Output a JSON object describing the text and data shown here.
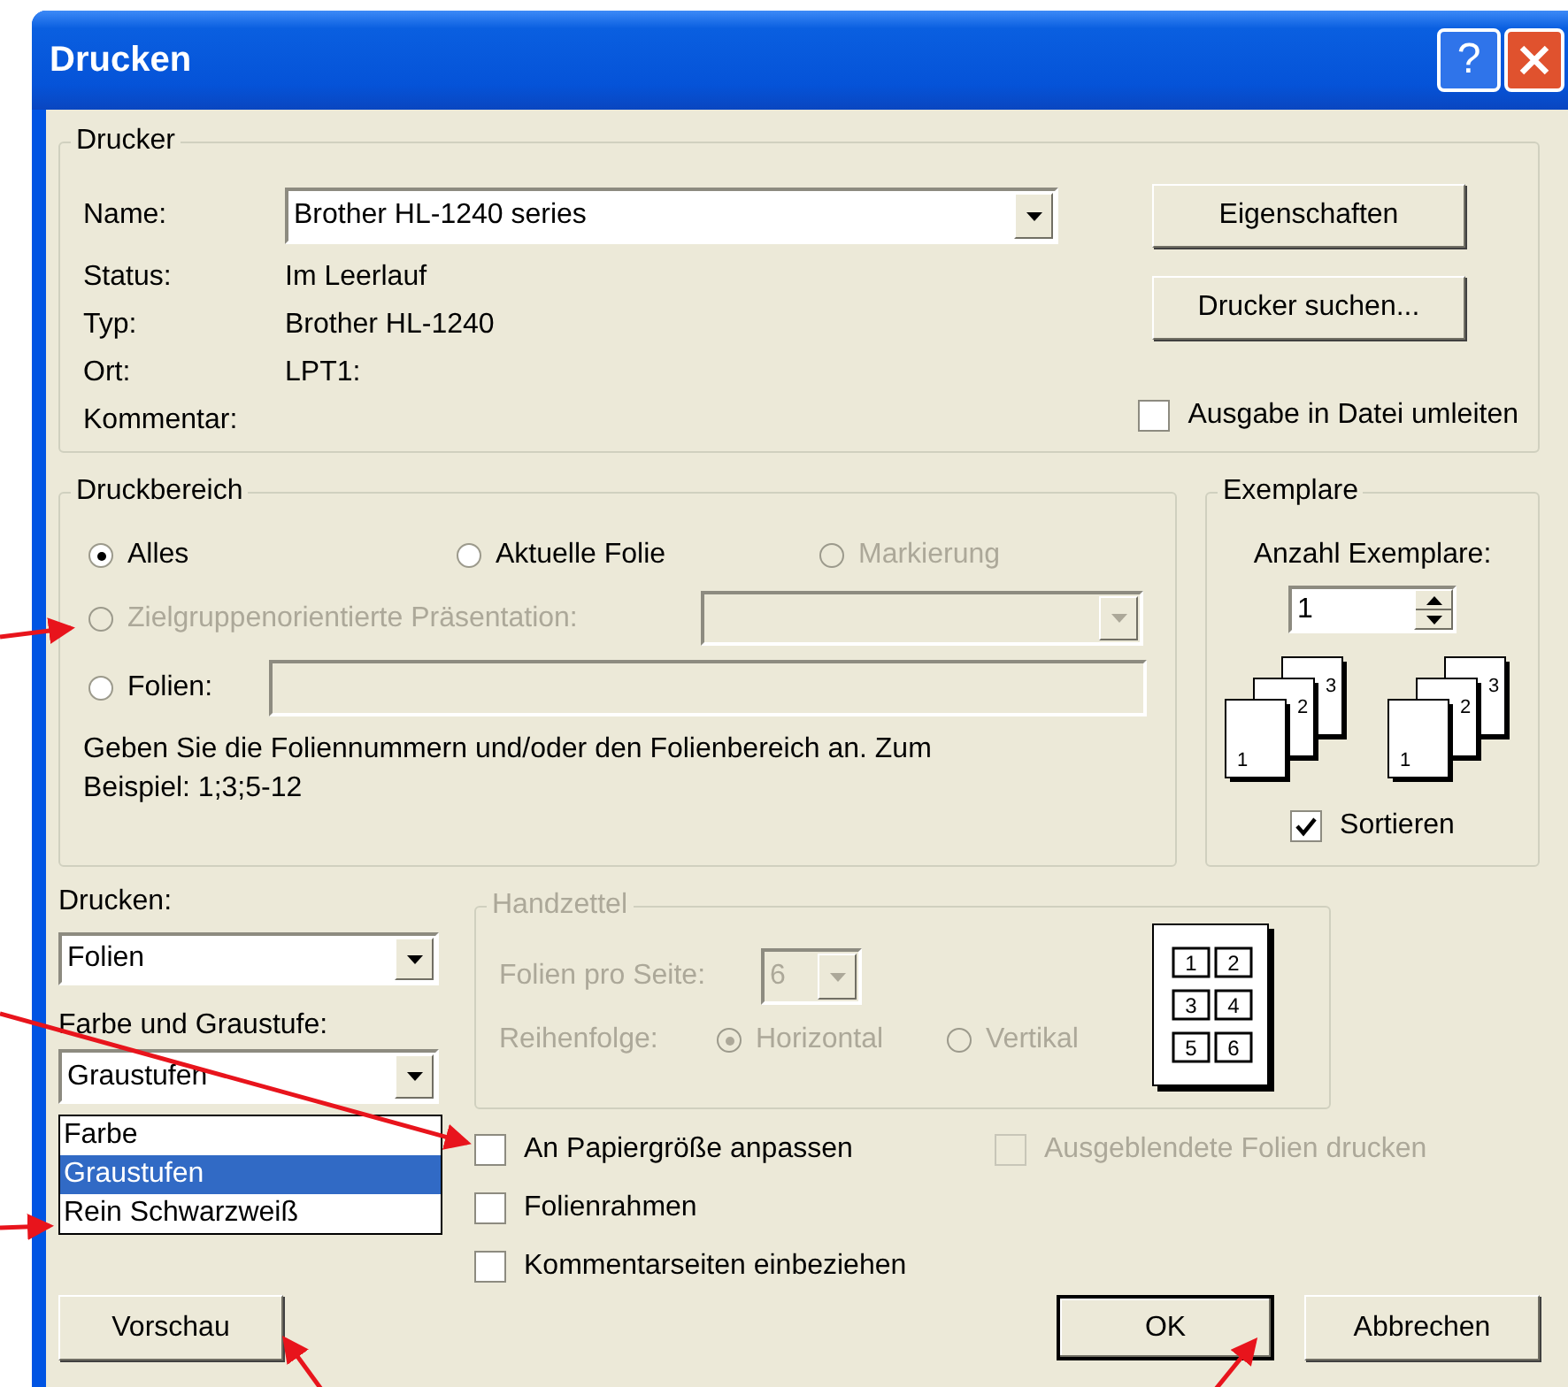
{
  "window": {
    "title": "Drucken",
    "help_button": "?"
  },
  "printer": {
    "legend": "Drucker",
    "name_label": "Name:",
    "name_value": "Brother HL-1240 series",
    "info": [
      {
        "label": "Status:",
        "value": "Im Leerlauf"
      },
      {
        "label": "Typ:",
        "value": "Brother HL-1240"
      },
      {
        "label": "Ort:",
        "value": "LPT1:"
      },
      {
        "label": "Kommentar:"
      }
    ],
    "buttons": [
      "Eigenschaften",
      "Drucker suchen..."
    ],
    "print_to_file": {
      "label": "Ausgabe in Datei umleiten",
      "checked": false
    }
  },
  "range": {
    "legend": "Druckbereich",
    "options": [
      {
        "label": "Alles",
        "selected": true,
        "disabled": false
      },
      {
        "label": "Aktuelle Folie",
        "selected": false,
        "disabled": false
      },
      {
        "label": "Markierung",
        "selected": false,
        "disabled": true
      },
      {
        "label": "Zielgruppenorientierte Präsentation:",
        "selected": false,
        "disabled": true
      },
      {
        "label": "Folien:",
        "selected": false,
        "disabled": false
      }
    ],
    "hint": "Geben Sie die Foliennummern und/oder den Folienbereich an. Zum Beispiel: 1;3;5-12"
  },
  "copies": {
    "legend": "Exemplare",
    "count_label": "Anzahl Exemplare:",
    "count": "1",
    "collate_stacks": [
      [
        "1",
        "2",
        "3"
      ],
      [
        "1",
        "2",
        "3"
      ]
    ],
    "collate": {
      "label": "Sortieren",
      "checked": true
    }
  },
  "print_what": {
    "label": "Drucken:",
    "value": "Folien"
  },
  "color": {
    "label": "Farbe und Graustufe:",
    "value": "Graustufen",
    "expanded": true,
    "options": [
      {
        "label": "Farbe",
        "selected": false
      },
      {
        "label": "Graustufen",
        "selected": true
      },
      {
        "label": "Rein Schwarzweiß",
        "selected": false
      }
    ]
  },
  "handouts": {
    "legend": "Handzettel",
    "disabled": true,
    "per_page_label": "Folien pro Seite:",
    "per_page": "6",
    "order_label": "Reihenfolge:",
    "order_options": [
      {
        "label": "Horizontal",
        "selected": true
      },
      {
        "label": "Vertikal",
        "selected": false
      }
    ],
    "preview_numbers": [
      "1",
      "2",
      "3",
      "4",
      "5",
      "6"
    ]
  },
  "option_rows": [
    [
      {
        "label": "An Papiergröße anpassen",
        "checked": false,
        "disabled": false
      },
      {
        "label": "Ausgeblendete Folien drucken",
        "checked": false,
        "disabled": true
      }
    ],
    [
      {
        "label": "Folienrahmen",
        "checked": false,
        "disabled": false
      }
    ],
    [
      {
        "label": "Kommentarseiten einbeziehen",
        "checked": false,
        "disabled": false
      }
    ]
  ],
  "buttons": [
    {
      "label": "Vorschau",
      "default": false
    },
    {
      "label": "OK",
      "default": true
    },
    {
      "label": "Abbrechen",
      "default": false
    }
  ]
}
